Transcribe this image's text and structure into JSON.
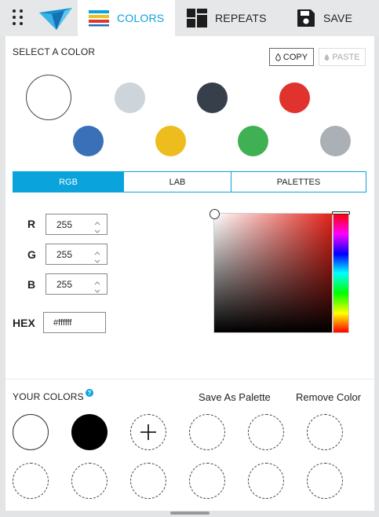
{
  "topbar": {
    "tabs": [
      {
        "label": "COLORS",
        "active": true
      },
      {
        "label": "REPEATS",
        "active": false
      },
      {
        "label": "SAVE",
        "active": false
      }
    ],
    "accent_color": "#0aa3dc"
  },
  "select_section": {
    "title": "SELECT A COLOR",
    "copy_label": "COPY",
    "paste_label": "PASTE",
    "swatches": [
      "#ffffff",
      "#cdd5da",
      "#37404a",
      "#e0332e",
      "#3970b8",
      "#ecbd1d",
      "#3fb154",
      "#abb0b6"
    ],
    "selected_swatch": "#ffffff"
  },
  "mode_tabs": [
    {
      "label": "RGB",
      "active": true
    },
    {
      "label": "LAB",
      "active": false
    },
    {
      "label": "PALETTES",
      "active": false
    }
  ],
  "rgb": {
    "channels": [
      {
        "label": "R",
        "value": "255"
      },
      {
        "label": "G",
        "value": "255"
      },
      {
        "label": "B",
        "value": "255"
      }
    ],
    "hex_label": "HEX",
    "hex_value": "#ffffff"
  },
  "your_colors": {
    "title": "YOUR COLORS",
    "help_icon": "question-icon",
    "save_palette_label": "Save As Palette",
    "remove_color_label": "Remove Color",
    "colors": [
      "#ffffff",
      "#000000"
    ],
    "add_icon": "plus-icon",
    "empty_slots": 9
  }
}
